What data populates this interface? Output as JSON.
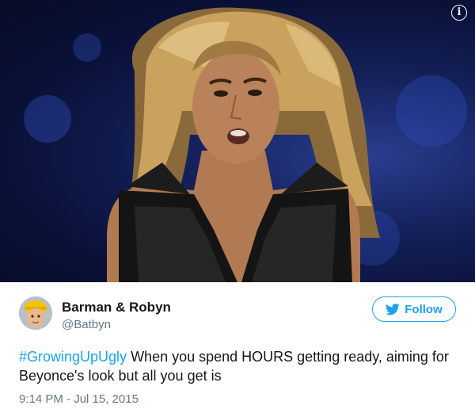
{
  "media": {
    "image_icon": "info-icon",
    "info_glyph": "i"
  },
  "author": {
    "name": "Barman & Robyn",
    "handle": "@Batbyn"
  },
  "follow_button": {
    "label": "Follow",
    "icon": "twitter-bird-icon"
  },
  "tweet": {
    "hashtag": "#GrowingUpUgly",
    "text": " When you spend HOURS getting ready, aiming for Beyonce's look but all you get is",
    "timestamp": "9:14 PM - Jul 15, 2015"
  },
  "colors": {
    "accent": "#1da1f2",
    "text": "#14171a",
    "muted": "#657786"
  }
}
